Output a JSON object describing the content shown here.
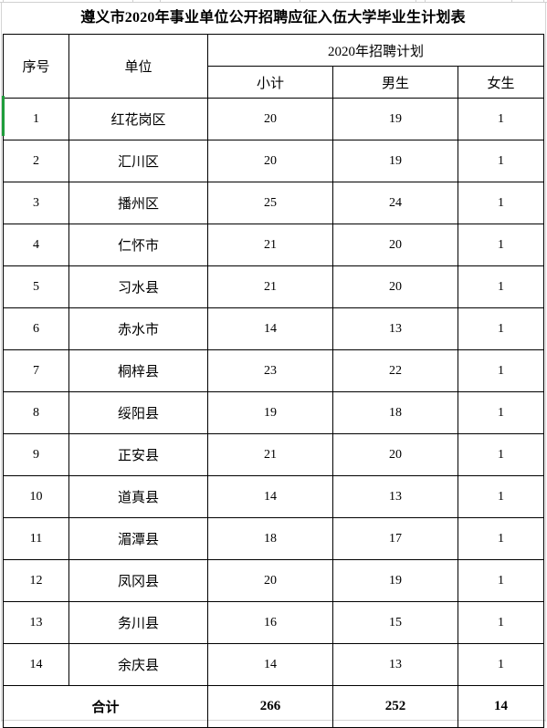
{
  "document": {
    "title": "遵义市2020年事业单位公开招聘应征入伍大学毕业生计划表"
  },
  "table": {
    "headers": {
      "index": "序号",
      "unit": "单位",
      "plan_group": "2020年招聘计划",
      "subtotal": "小计",
      "male": "男生",
      "female": "女生"
    },
    "rows": [
      {
        "index": "1",
        "unit": "红花岗区",
        "subtotal": "20",
        "male": "19",
        "female": "1"
      },
      {
        "index": "2",
        "unit": "汇川区",
        "subtotal": "20",
        "male": "19",
        "female": "1"
      },
      {
        "index": "3",
        "unit": "播州区",
        "subtotal": "25",
        "male": "24",
        "female": "1"
      },
      {
        "index": "4",
        "unit": "仁怀市",
        "subtotal": "21",
        "male": "20",
        "female": "1"
      },
      {
        "index": "5",
        "unit": "习水县",
        "subtotal": "21",
        "male": "20",
        "female": "1"
      },
      {
        "index": "6",
        "unit": "赤水市",
        "subtotal": "14",
        "male": "13",
        "female": "1"
      },
      {
        "index": "7",
        "unit": "桐梓县",
        "subtotal": "23",
        "male": "22",
        "female": "1"
      },
      {
        "index": "8",
        "unit": "绥阳县",
        "subtotal": "19",
        "male": "18",
        "female": "1"
      },
      {
        "index": "9",
        "unit": "正安县",
        "subtotal": "21",
        "male": "20",
        "female": "1"
      },
      {
        "index": "10",
        "unit": "道真县",
        "subtotal": "14",
        "male": "13",
        "female": "1"
      },
      {
        "index": "11",
        "unit": "湄潭县",
        "subtotal": "18",
        "male": "17",
        "female": "1"
      },
      {
        "index": "12",
        "unit": "凤冈县",
        "subtotal": "20",
        "male": "19",
        "female": "1"
      },
      {
        "index": "13",
        "unit": "务川县",
        "subtotal": "16",
        "male": "15",
        "female": "1"
      },
      {
        "index": "14",
        "unit": "余庆县",
        "subtotal": "14",
        "male": "13",
        "female": "1"
      }
    ],
    "total": {
      "label": "合计",
      "subtotal": "266",
      "male": "252",
      "female": "14"
    }
  },
  "selection": {
    "marker_color": "#1f9d3b"
  }
}
